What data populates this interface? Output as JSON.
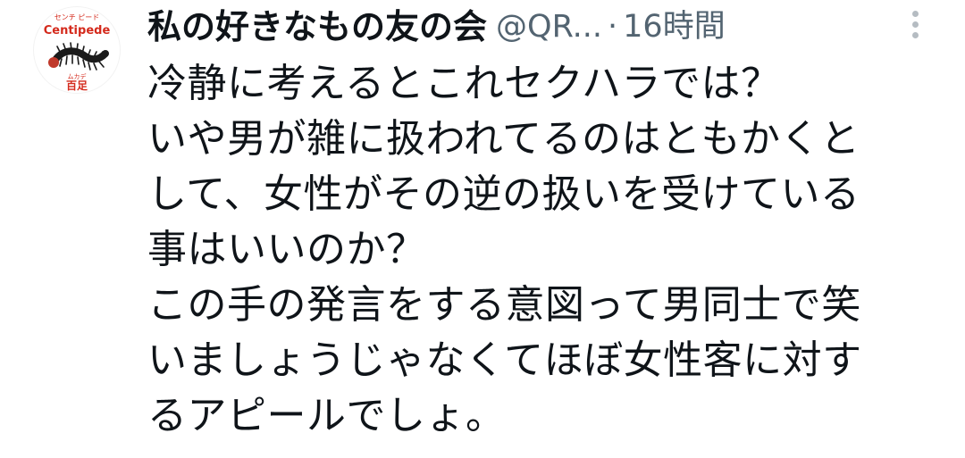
{
  "tweet": {
    "display_name": "私の好きなもの友の会",
    "handle": "@QR...",
    "separator": "·",
    "time": "16時間",
    "avatar": {
      "top_text": "センチ ピード",
      "logo_text": "Centipede",
      "sub_text": "ムカデ",
      "kanji": "百足",
      "brand_color": "#d42a1c"
    },
    "body_lines": [
      "冷静に考えるとこれセクハラでは？",
      "いや男が雑に扱われてるのはともかくと",
      "して、女性がその逆の扱いを受けている",
      "事はいいのか？",
      "この手の発言をする意図って男同士で笑",
      "いましょうじゃなくてほぼ女性客に対す",
      "るアピールでしょ。"
    ],
    "more_icon": "vertical-ellipsis-icon"
  },
  "colors": {
    "text": "#0f1419",
    "secondary": "#536471",
    "icon": "#b5bcc2"
  }
}
